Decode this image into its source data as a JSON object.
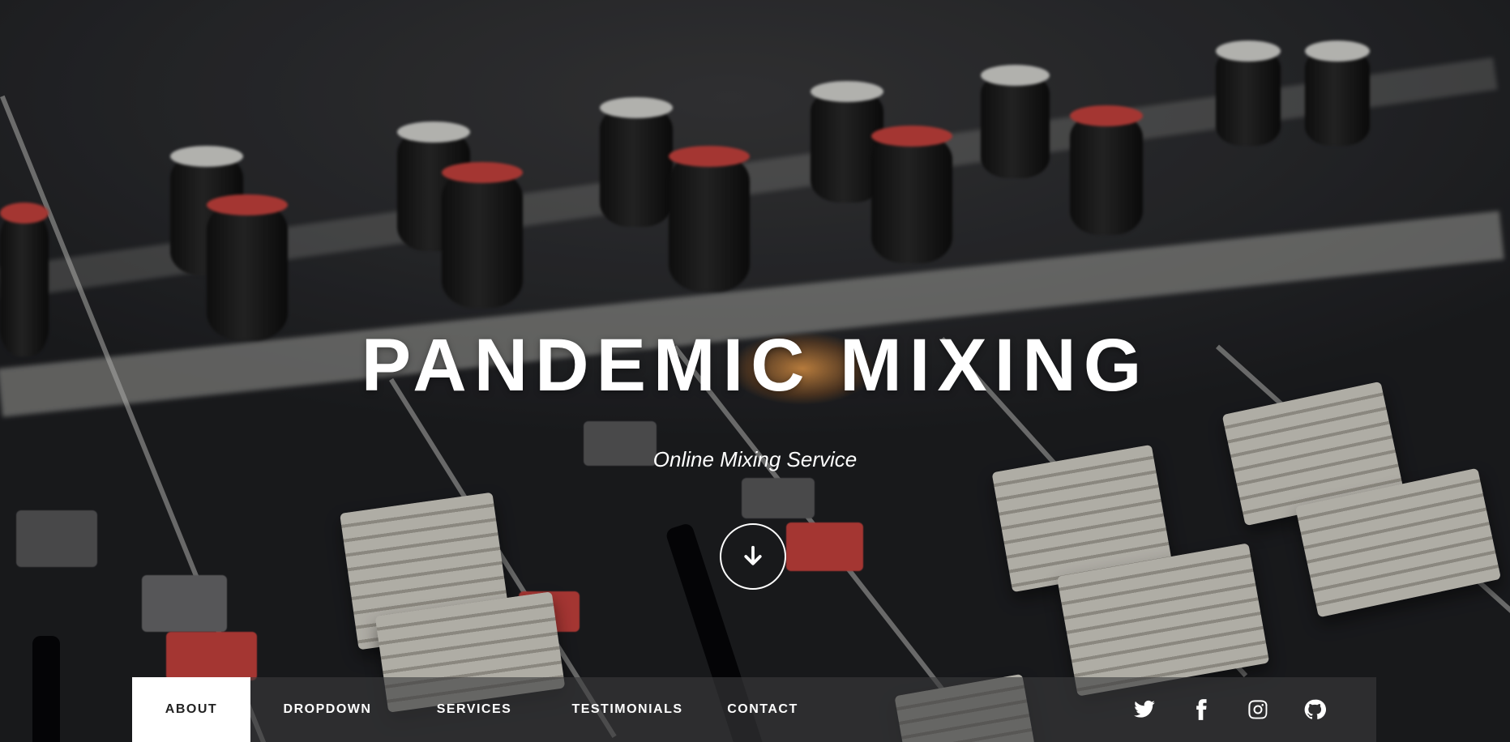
{
  "hero": {
    "title": "PANDEMIC MIXING",
    "subtitle": "Online Mixing Service",
    "scroll_icon": "arrow-down-icon"
  },
  "nav": {
    "items": [
      {
        "label": "ABOUT",
        "active": true
      },
      {
        "label": "DROPDOWN",
        "active": false
      },
      {
        "label": "SERVICES",
        "active": false
      },
      {
        "label": "TESTIMONIALS",
        "active": false
      },
      {
        "label": "CONTACT",
        "active": false
      }
    ],
    "social": [
      "twitter-icon",
      "facebook-icon",
      "instagram-icon",
      "github-icon"
    ]
  },
  "colors": {
    "nav_background": "#3a3a3c",
    "active_tab_background": "#ffffff",
    "text": "#ffffff"
  }
}
